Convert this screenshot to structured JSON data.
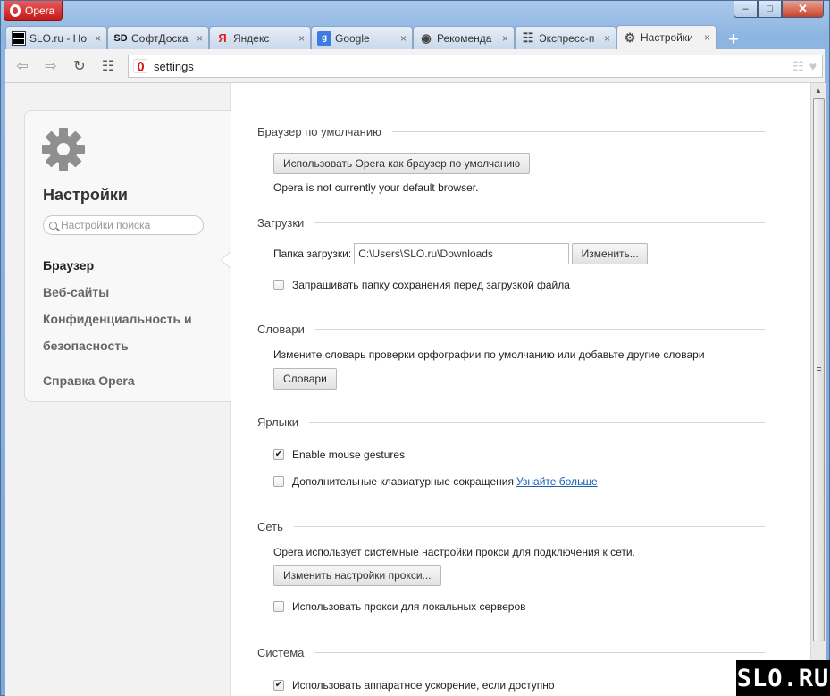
{
  "window": {
    "menu_label": "Opera",
    "controls": {
      "minimize": "–",
      "maximize": "□",
      "close": "✕"
    }
  },
  "tabs": [
    {
      "title": "SLO.ru - Но",
      "favicon": "slo-favicon",
      "badge": "SLO"
    },
    {
      "title": "СофтДоска",
      "favicon": "sd-favicon",
      "badge": "SD"
    },
    {
      "title": "Яндекс",
      "favicon": "yandex-favicon",
      "badge": "Я"
    },
    {
      "title": "Google",
      "favicon": "google-favicon",
      "badge": "g"
    },
    {
      "title": "Рекоменда",
      "favicon": "eye-icon",
      "badge": "◉"
    },
    {
      "title": "Экспресс-п",
      "favicon": "speed-dial-icon",
      "badge": "☷"
    },
    {
      "title": "Настройки",
      "favicon": "gear-icon",
      "badge": "⚙",
      "active": true
    }
  ],
  "tab_close": "×",
  "new_tab": "+",
  "toolbar": {
    "back": "⇦",
    "forward": "⇨",
    "reload": "↻",
    "speed_dial": "☷",
    "address": "settings",
    "right_icons": [
      "☷",
      "♥"
    ]
  },
  "sidebar": {
    "title": "Настройки",
    "search_placeholder": "Настройки поиска",
    "items": [
      {
        "label": "Браузер",
        "active": true
      },
      {
        "label": "Веб-сайты"
      },
      {
        "label": "Конфиденциальность и"
      },
      {
        "label": "безопасность"
      },
      {
        "label": "Справка Opera"
      }
    ]
  },
  "sections": {
    "default_browser": {
      "title": "Браузер по умолчанию",
      "button": "Использовать Opera как браузер по умолчанию",
      "status": "Opera is not currently your default browser."
    },
    "downloads": {
      "title": "Загрузки",
      "folder_label": "Папка загрузки:",
      "folder_value": "C:\\Users\\SLO.ru\\Downloads",
      "change_button": "Изменить...",
      "ask_label": "Запрашивать папку сохранения перед загрузкой файла",
      "ask_checked": false
    },
    "dictionaries": {
      "title": "Словари",
      "description": "Измените словарь проверки орфографии по умолчанию или добавьте другие словари",
      "button": "Словари"
    },
    "shortcuts": {
      "title": "Ярлыки",
      "gestures_label": "Enable mouse gestures",
      "gestures_checked": true,
      "keyboard_label": "Дополнительные клавиатурные сокращения",
      "keyboard_checked": false,
      "learn_more": "Узнайте больше"
    },
    "network": {
      "title": "Сеть",
      "description": "Opera использует системные настройки прокси для подключения к сети.",
      "button": "Изменить настройки прокси...",
      "local_proxy_label": "Использовать прокси для локальных серверов",
      "local_proxy_checked": false
    },
    "system": {
      "title": "Система",
      "hw_accel_label": "Использовать аппаратное ускорение, если доступно",
      "hw_accel_checked": true
    }
  },
  "check_mark": "✔",
  "watermark": "SLO.RU"
}
